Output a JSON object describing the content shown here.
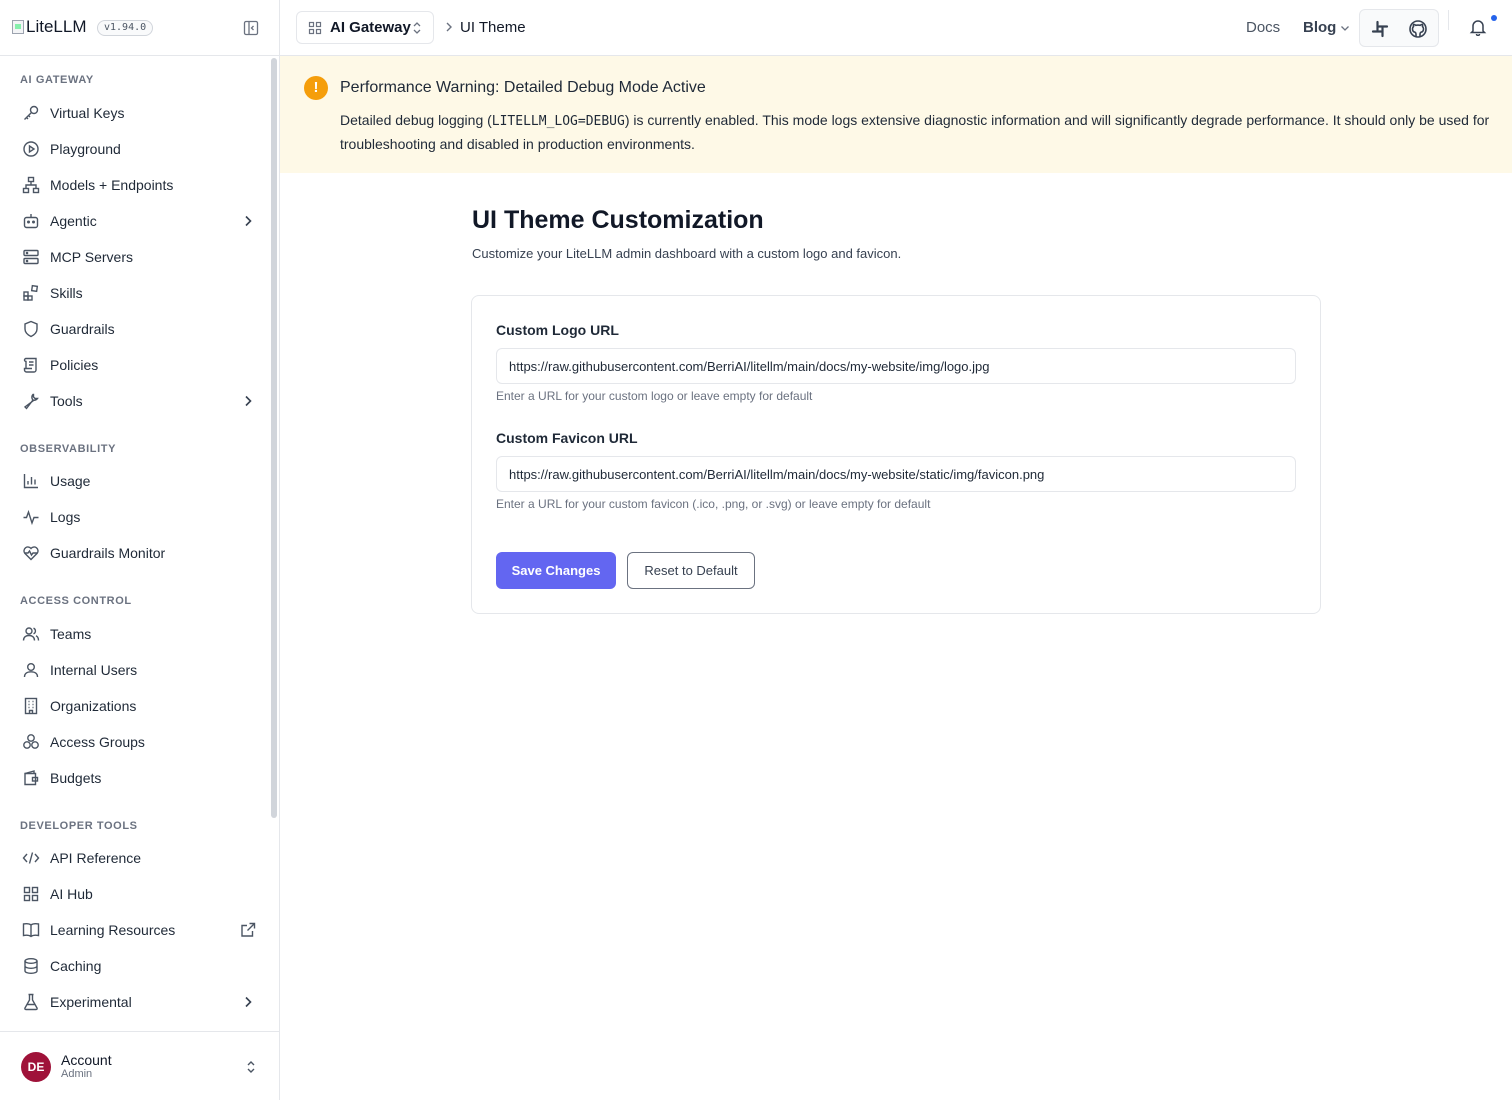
{
  "brand": {
    "logo_alt": "LiteLLM",
    "version": "v1.94.0"
  },
  "sidebar": {
    "sections": {
      "ai_gateway": "AI GATEWAY",
      "observability": "OBSERVABILITY",
      "access_control": "ACCESS CONTROL",
      "developer_tools": "DEVELOPER TOOLS"
    },
    "items": {
      "virtual_keys": "Virtual Keys",
      "playground": "Playground",
      "models_endpoints": "Models + Endpoints",
      "agentic": "Agentic",
      "mcp_servers": "MCP Servers",
      "skills": "Skills",
      "guardrails": "Guardrails",
      "policies": "Policies",
      "tools": "Tools",
      "usage": "Usage",
      "logs": "Logs",
      "guardrails_monitor": "Guardrails Monitor",
      "teams": "Teams",
      "internal_users": "Internal Users",
      "organizations": "Organizations",
      "access_groups": "Access Groups",
      "budgets": "Budgets",
      "api_reference": "API Reference",
      "ai_hub": "AI Hub",
      "learning_resources": "Learning Resources",
      "caching": "Caching",
      "experimental": "Experimental"
    },
    "account": {
      "initials": "DE",
      "name": "Account",
      "role": "Admin"
    }
  },
  "topbar": {
    "gateway": "AI Gateway",
    "current_page": "UI Theme",
    "docs": "Docs",
    "blog": "Blog"
  },
  "warning": {
    "title": "Performance Warning: Detailed Debug Mode Active",
    "body_before": "Detailed debug logging (",
    "body_code": "LITELLM_LOG=DEBUG",
    "body_after": ") is currently enabled. This mode logs extensive diagnostic information and will significantly degrade performance. It should only be used for troubleshooting and disabled in production environments."
  },
  "main": {
    "title": "UI Theme Customization",
    "subtitle": "Customize your LiteLLM admin dashboard with a custom logo and favicon.",
    "logo_field": {
      "label": "Custom Logo URL",
      "value": "https://raw.githubusercontent.com/BerriAI/litellm/main/docs/my-website/img/logo.jpg",
      "help": "Enter a URL for your custom logo or leave empty for default"
    },
    "favicon_field": {
      "label": "Custom Favicon URL",
      "value": "https://raw.githubusercontent.com/BerriAI/litellm/main/docs/my-website/static/img/favicon.png",
      "help": "Enter a URL for your custom favicon (.ico, .png, or .svg) or leave empty for default"
    },
    "save_label": "Save Changes",
    "reset_label": "Reset to Default"
  },
  "colors": {
    "accent": "#6366f1",
    "warning_bg": "#fef9e7",
    "warning_icon": "#f59e0b",
    "avatar": "#9f1239"
  }
}
